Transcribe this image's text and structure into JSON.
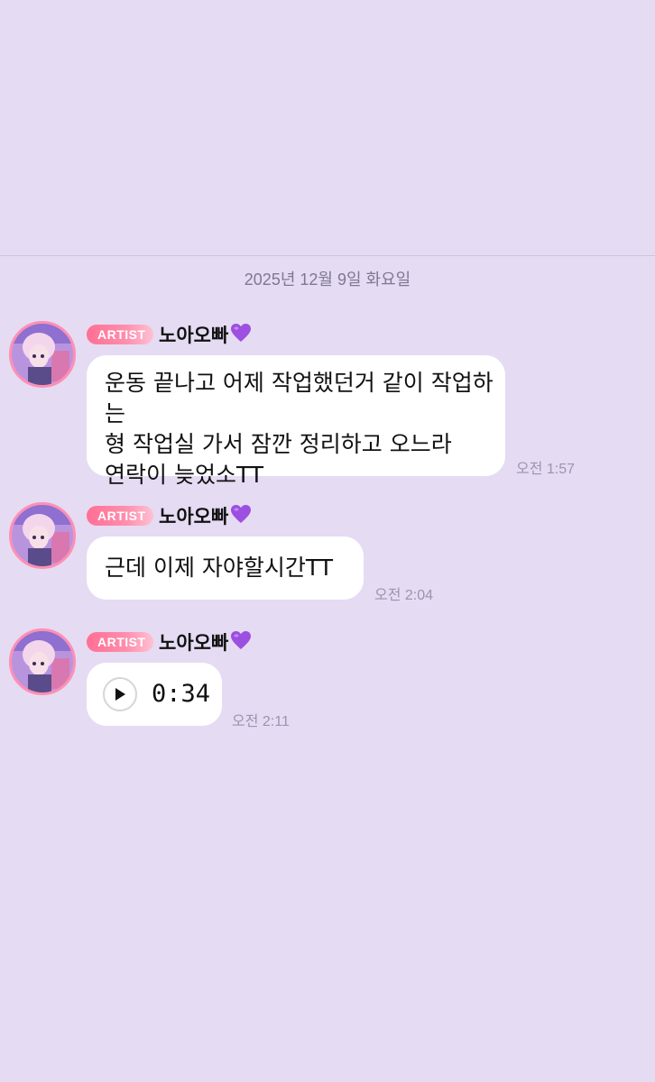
{
  "chat": {
    "date_label": "2025년 12월 9일 화요일",
    "badge_label": "ARTIST",
    "sender": "노아오빠",
    "accent_pink": "#ff6f93",
    "background": "#e5dbf3",
    "messages": [
      {
        "lines": [
          "운동 끝나고 어제 작업했던거 같이 작업하는",
          "형 작업실 가서 잠깐 정리하고 오느라",
          "연락이 늦었소TT"
        ],
        "time": "오전 1:57"
      },
      {
        "lines": [
          "근데 이제 자야할시간TT"
        ],
        "time": "오전 2:04"
      },
      {
        "type": "voice",
        "duration": "0:34",
        "time": "오전 2:11"
      }
    ]
  },
  "icons": {
    "heart": "purple-heart-icon",
    "play": "play-icon",
    "avatar": "artist-avatar"
  }
}
